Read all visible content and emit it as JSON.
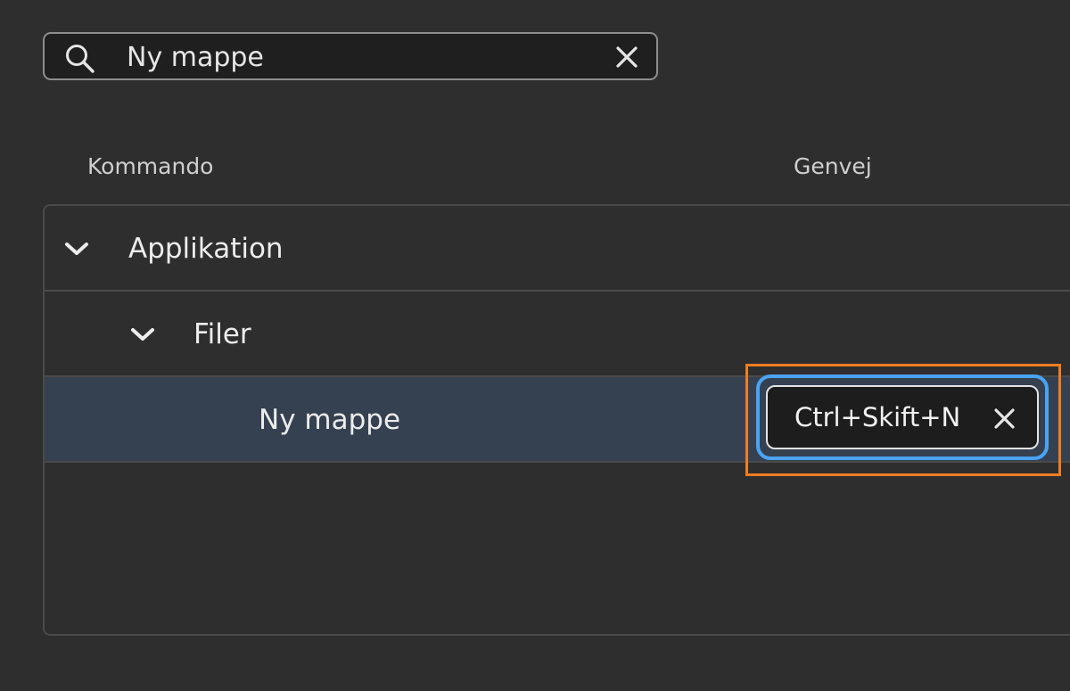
{
  "search": {
    "value": "Ny mappe",
    "icon": "search-icon",
    "clear_icon": "close-icon"
  },
  "columns": {
    "command": "Kommando",
    "shortcut": "Genvej"
  },
  "tree": {
    "group": "Applikation",
    "subgroup": "Filer",
    "item": "Ny mappe"
  },
  "shortcut": {
    "value": "Ctrl+Skift+N",
    "clear_icon": "close-icon"
  },
  "colors": {
    "background": "#2e2e2e",
    "selected_row": "#354150",
    "focus_ring": "#4aa3f3",
    "highlight_box": "#ef7d22"
  }
}
